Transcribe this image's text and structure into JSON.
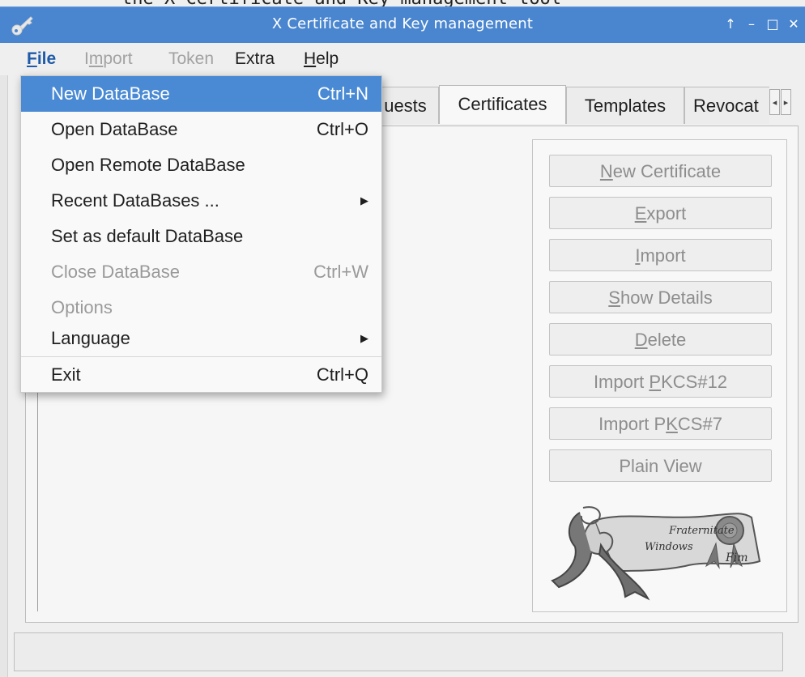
{
  "window": {
    "title": "X Certificate and Key management",
    "controls": [
      "↑",
      "–",
      "□",
      "✕"
    ],
    "accent": "#4a86cf"
  },
  "background_text": "the X Certificate and Key management tool",
  "menubar": {
    "items": [
      {
        "label": "File",
        "underline": "F",
        "state": "open"
      },
      {
        "label": "Import",
        "underline": "m",
        "state": "disabled"
      },
      {
        "label": "Token",
        "state": "disabled"
      },
      {
        "label": "Extra",
        "state": "enabled"
      },
      {
        "label": "Help",
        "underline": "H",
        "state": "enabled"
      }
    ]
  },
  "file_menu": {
    "items": [
      {
        "label": "New DataBase",
        "shortcut": "Ctrl+N",
        "selected": true
      },
      {
        "label": "Open DataBase",
        "shortcut": "Ctrl+O"
      },
      {
        "label": "Open Remote DataBase"
      },
      {
        "label": "Recent DataBases ...",
        "submenu": true
      },
      {
        "label": "Set as default DataBase"
      },
      {
        "label": "Close DataBase",
        "shortcut": "Ctrl+W",
        "disabled": true
      },
      {
        "label": "Options",
        "disabled": true
      },
      {
        "label": "Language",
        "submenu": true
      },
      {
        "label": "Exit",
        "shortcut": "Ctrl+Q"
      }
    ]
  },
  "tabs": [
    {
      "label": "uests"
    },
    {
      "label": "Certificates",
      "active": true
    },
    {
      "label": "Templates"
    },
    {
      "label": "Revocat"
    }
  ],
  "buttons": [
    {
      "label": "New Certificate",
      "mnemonic": "N"
    },
    {
      "label": "Export",
      "mnemonic": "E"
    },
    {
      "label": "Import",
      "mnemonic": "I"
    },
    {
      "label": "Show Details",
      "mnemonic": "S"
    },
    {
      "label": "Delete",
      "mnemonic": "D"
    },
    {
      "label": "Import PKCS#12",
      "mnemonic": "P"
    },
    {
      "label": "Import PKCS#7",
      "mnemonic": "K"
    },
    {
      "label": "Plain View"
    }
  ],
  "logo_text": [
    "Fraternitate",
    "Windows",
    "Fim"
  ]
}
